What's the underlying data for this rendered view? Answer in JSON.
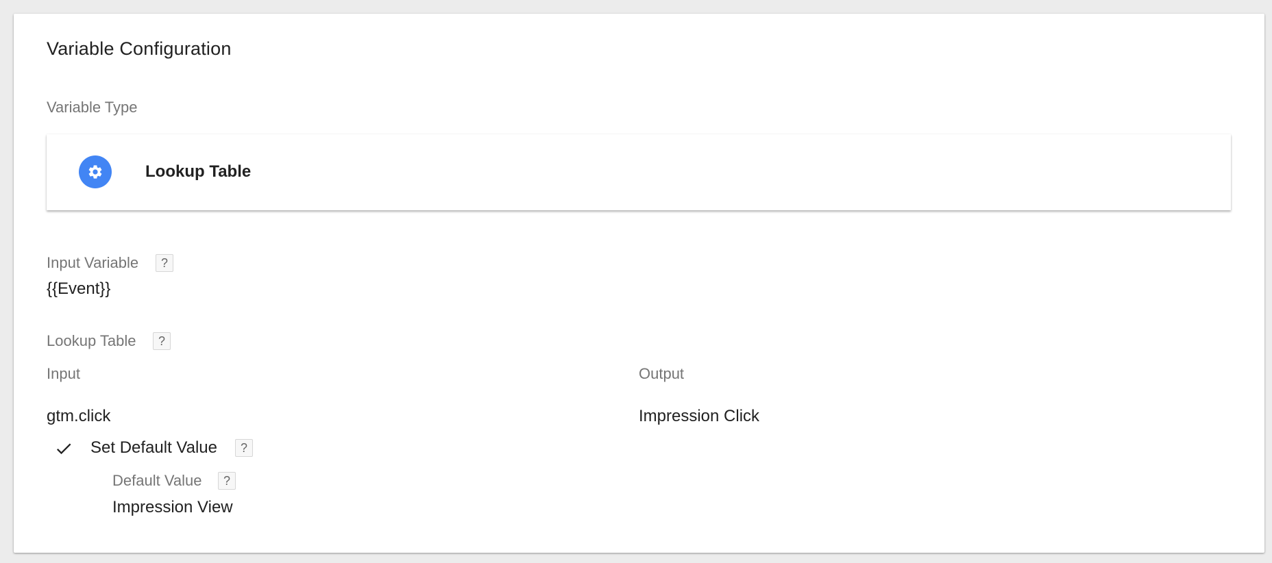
{
  "section": {
    "title": "Variable Configuration"
  },
  "variable_type": {
    "label": "Variable Type",
    "name": "Lookup Table",
    "icon": "gear-icon",
    "icon_color": "#4285f4"
  },
  "input_variable": {
    "label": "Input Variable",
    "help": "?",
    "value": "{{Event}}"
  },
  "lookup_table": {
    "label": "Lookup Table",
    "help": "?",
    "columns": {
      "input": "Input",
      "output": "Output"
    },
    "rows": [
      {
        "input": "gtm.click",
        "output": "Impression Click"
      }
    ]
  },
  "default_value": {
    "checkbox_label": "Set Default Value",
    "checked": true,
    "help": "?",
    "label": "Default Value",
    "value": "Impression View"
  }
}
